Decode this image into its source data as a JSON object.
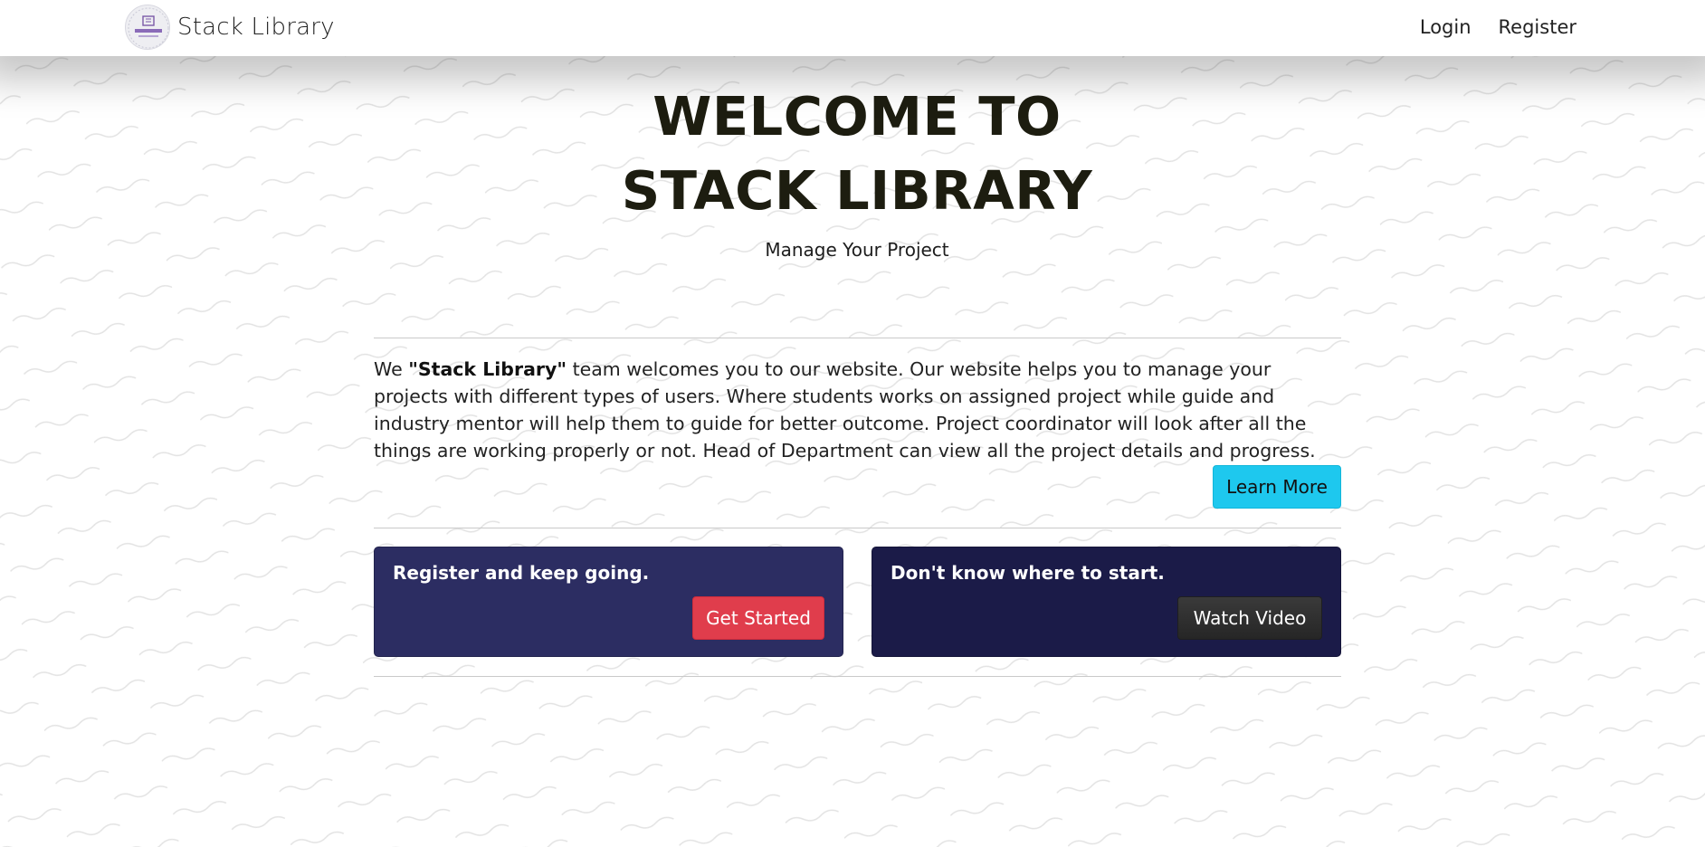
{
  "navbar": {
    "brand_name": "Stack Library",
    "logo_text": "STACK LIBRARY",
    "links": [
      "Login",
      "Register"
    ]
  },
  "hero": {
    "title_line1": "WELCOME TO",
    "title_line2": "STACK LIBRARY",
    "subtitle": "Manage Your Project"
  },
  "intro": {
    "prefix": "We ",
    "highlight": "\"Stack Library\"",
    "body": " team welcomes you to our website. Our website helps you to manage your projects with different types of users. Where students works on assigned project while guide and industry mentor will help them to guide for better outcome. Project coordinator will look after all the things are working properly or not. Head of Department can view all the project details and progress.",
    "learn_more_label": "Learn More"
  },
  "cards": [
    {
      "title": "Register and keep going.",
      "button_label": "Get Started",
      "color": "#2c2d62",
      "button_color": "#e03d4c"
    },
    {
      "title": "Don't know where to start.",
      "button_label": "Watch Video",
      "color": "#1b1b48",
      "button_color": "#2f2f2f"
    }
  ],
  "colors": {
    "accent": "#1ec8ee",
    "title": "#1d1d10"
  }
}
